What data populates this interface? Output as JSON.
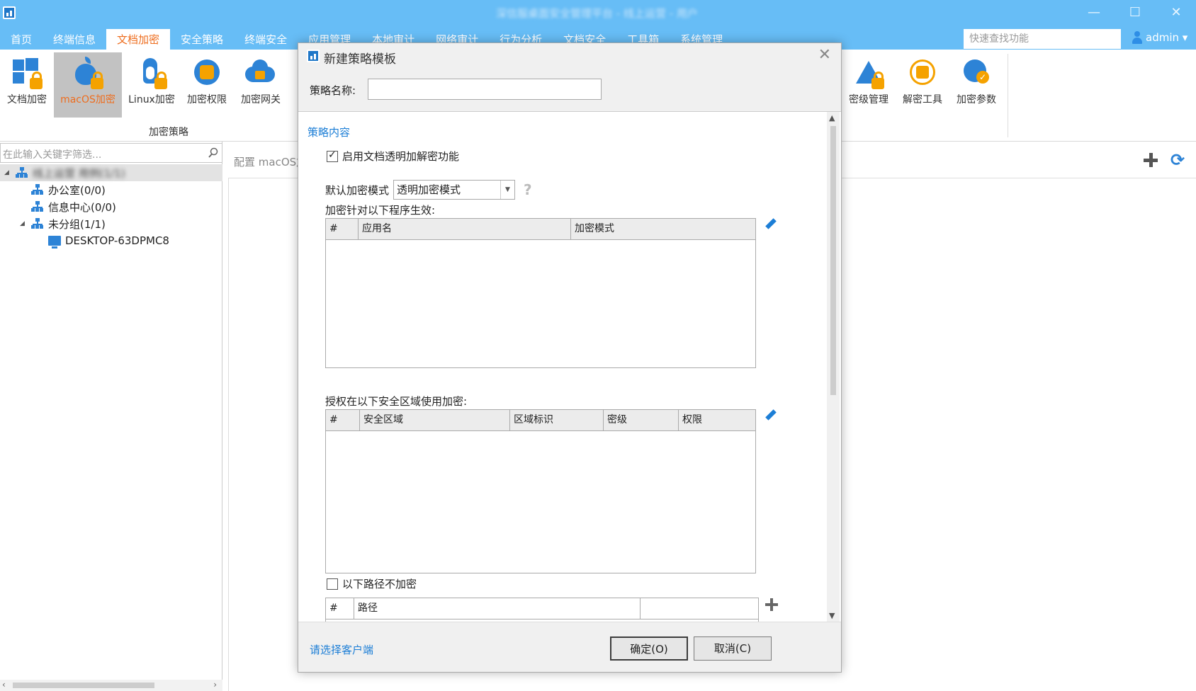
{
  "window": {
    "title": "深信服桌面安全管理平台 - 线上运营 - 用户",
    "minimize": "—",
    "maximize": "☐",
    "close": "✕"
  },
  "menu": {
    "items": [
      "首页",
      "终端信息",
      "文档加密",
      "安全策略",
      "终端安全",
      "应用管理",
      "本地审计",
      "网络审计",
      "行为分析",
      "文档安全",
      "工具箱",
      "系统管理"
    ],
    "active_index": 2,
    "search_placeholder": "快速查找功能",
    "user": "admin ▾"
  },
  "ribbon": {
    "buttons": [
      {
        "label": "文档加密",
        "icon": "windows-lock-icon"
      },
      {
        "label": "macOS加密",
        "icon": "apple-lock-icon",
        "selected": true
      },
      {
        "label": "Linux加密",
        "icon": "linux-lock-icon"
      },
      {
        "label": "加密权限",
        "icon": "gear-lock-icon"
      },
      {
        "label": "加密网关",
        "icon": "cloud-lock-icon"
      }
    ],
    "group_label": "加密策略",
    "right_buttons": [
      {
        "label": "密级管理",
        "icon": "pyramid-lock-icon"
      },
      {
        "label": "解密工具",
        "icon": "target-lock-icon"
      },
      {
        "label": "加密参数",
        "icon": "gear-check-icon"
      }
    ]
  },
  "tree": {
    "filter_placeholder": "在此输入关键字筛选...",
    "root": "线上运营 用例(1/1)",
    "nodes": [
      {
        "label": "办公室(0/0)"
      },
      {
        "label": "信息中心(0/0)"
      },
      {
        "label": "未分组(1/1)"
      },
      {
        "label": "DESKTOP-63DPMC8"
      }
    ]
  },
  "content": {
    "breadcrumb": "配置 macOS加密"
  },
  "dialog": {
    "title": "新建策略模板",
    "name_label": "策略名称:",
    "name_value": "",
    "section_title": "策略内容",
    "enable_label": "启用文档透明加解密功能",
    "enable_checked": true,
    "default_mode_label": "默认加密模式",
    "default_mode_value": "透明加密模式",
    "help": "?",
    "programs_label": "加密针对以下程序生效:",
    "programs_columns": [
      "#",
      "应用名",
      "加密模式"
    ],
    "zones_label": "授权在以下安全区域使用加密:",
    "zones_columns": [
      "#",
      "安全区域",
      "区域标识",
      "密级",
      "权限"
    ],
    "exclude_label": "以下路径不加密",
    "exclude_checked": false,
    "paths_columns": [
      "#",
      "路径",
      ""
    ],
    "client_link": "请选择客户端",
    "ok": "确定(O)",
    "cancel": "取消(C)"
  }
}
